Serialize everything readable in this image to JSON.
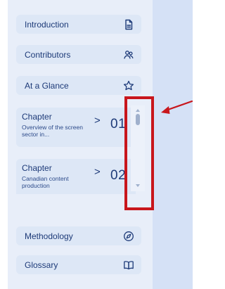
{
  "sidebar": {
    "top_items": [
      {
        "label": "Introduction",
        "icon": "document-icon"
      },
      {
        "label": "Contributors",
        "icon": "people-icon"
      },
      {
        "label": "At a Glance",
        "icon": "star-icon"
      }
    ],
    "chapters": [
      {
        "title": "Chapter",
        "description": "Overview of the screen sector in...",
        "number": "01"
      },
      {
        "title": "Chapter",
        "description": "Canadian content production",
        "number": "02"
      }
    ],
    "bottom_items": [
      {
        "label": "Methodology",
        "icon": "compass-icon"
      },
      {
        "label": "Glossary",
        "icon": "book-icon"
      }
    ]
  },
  "scroll": {
    "position_fraction": 0.0
  },
  "colors": {
    "accent": "#1d3a78",
    "highlight": "#c8161c",
    "sidebar_bg": "#e8eef9",
    "item_bg": "#dde7f6",
    "content_bg": "#d5e1f6"
  }
}
